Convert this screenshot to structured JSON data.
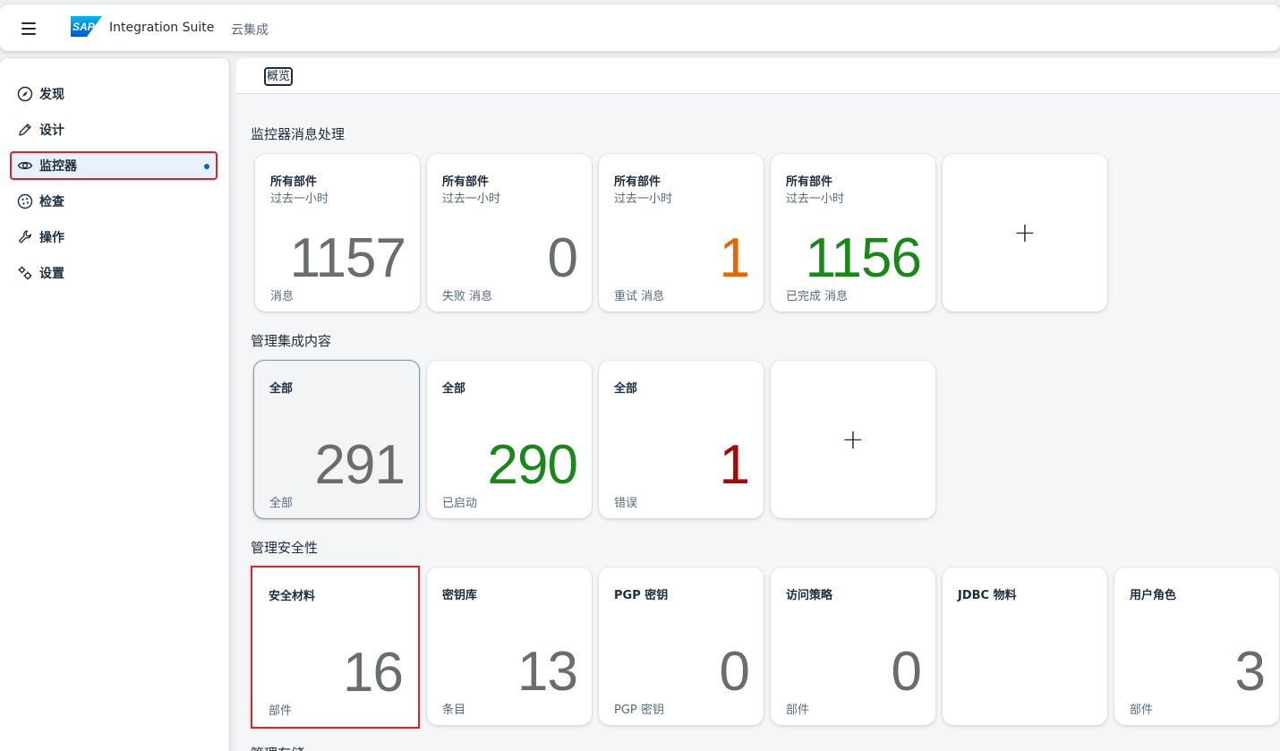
{
  "shell": {
    "logo_text": "SAP",
    "title": "Integration Suite",
    "subtitle": "云集成"
  },
  "sidebar": {
    "items": [
      {
        "label": "发现",
        "icon": "compass-icon"
      },
      {
        "label": "设计",
        "icon": "pencil-icon"
      },
      {
        "label": "监控器",
        "icon": "eye-icon",
        "selected": true
      },
      {
        "label": "检查",
        "icon": "inspect-icon"
      },
      {
        "label": "操作",
        "icon": "wrench-icon"
      },
      {
        "label": "设置",
        "icon": "gears-icon"
      }
    ]
  },
  "tabs": {
    "overview": "概览"
  },
  "sections": {
    "messages": {
      "title": "监控器消息处理",
      "tiles": [
        {
          "title": "所有部件",
          "subtitle": "过去一小时",
          "value": "1157",
          "footer": "消息",
          "color": "#6a6d70"
        },
        {
          "title": "所有部件",
          "subtitle": "过去一小时",
          "value": "0",
          "footer": "失败 消息",
          "color": "#6a6d70"
        },
        {
          "title": "所有部件",
          "subtitle": "过去一小时",
          "value": "1",
          "footer": "重试 消息",
          "color": "#e76500"
        },
        {
          "title": "所有部件",
          "subtitle": "过去一小时",
          "value": "1156",
          "footer": "已完成 消息",
          "color": "#188918"
        }
      ],
      "add_label": "+"
    },
    "content": {
      "title": "管理集成内容",
      "tiles": [
        {
          "title": "全部",
          "value": "291",
          "footer": "全部",
          "color": "#6a6d70"
        },
        {
          "title": "全部",
          "value": "290",
          "footer": "已启动",
          "color": "#188918"
        },
        {
          "title": "全部",
          "value": "1",
          "footer": "错误",
          "color": "#aa0808"
        }
      ],
      "add_label": "+"
    },
    "security": {
      "title": "管理安全性",
      "tiles": [
        {
          "title": "安全材料",
          "value": "16",
          "footer": "部件"
        },
        {
          "title": "密钥库",
          "value": "13",
          "footer": "条目"
        },
        {
          "title": "PGP 密钥",
          "value": "0",
          "footer": "PGP 密钥"
        },
        {
          "title": "访问策略",
          "value": "0",
          "footer": "部件"
        },
        {
          "title": "JDBC 物料",
          "value": "",
          "footer": ""
        },
        {
          "title": "用户角色",
          "value": "3",
          "footer": "部件"
        }
      ]
    },
    "storage": {
      "title": "管理存储"
    }
  },
  "colors": {
    "brand": "#0a6ed1",
    "selection": "#e0202b",
    "neutral_value": "#6a6d70",
    "positive": "#188918",
    "critical": "#e76500",
    "negative": "#aa0808"
  }
}
